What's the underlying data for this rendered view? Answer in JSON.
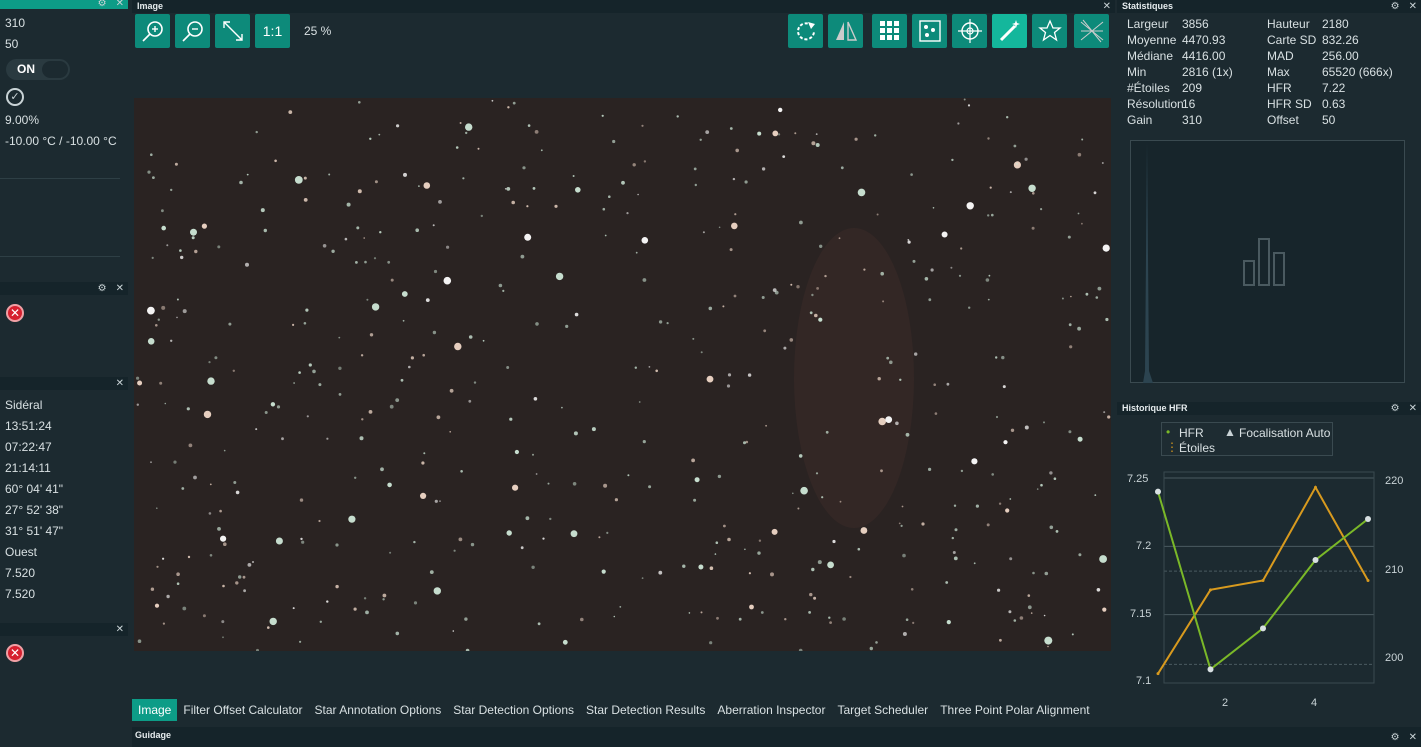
{
  "left": {
    "gain": "310",
    "offset": "50",
    "cooler_toggle": "ON",
    "cooler_power": "9.00%",
    "temperature": "-10.00 °C / -10.00 °C",
    "telescope": {
      "tracking": "Sidéral",
      "sidereal_time": "13:51:24",
      "time1": "07:22:47",
      "time2": "21:14:11",
      "coord1": "60° 04' 41\"",
      "coord2": "27° 52' 38\"",
      "coord3": "31° 51' 47\"",
      "pier_side": "Ouest",
      "value1": "7.520",
      "value2": "7.520"
    }
  },
  "image": {
    "title": "Image",
    "zoom": "25 %",
    "one_to_one": "1:1",
    "tabs": [
      "Image",
      "Filter Offset Calculator",
      "Star Annotation Options",
      "Star Detection Options",
      "Star Detection Results",
      "Aberration Inspector",
      "Target Scheduler",
      "Three Point Polar Alignment"
    ]
  },
  "stats": {
    "title": "Statistiques",
    "rows": [
      {
        "l1": "Largeur",
        "v1": "3856",
        "l2": "Hauteur",
        "v2": "2180"
      },
      {
        "l1": "Moyenne",
        "v1": "4470.93",
        "l2": "Carte SD",
        "v2": "832.26"
      },
      {
        "l1": "Médiane",
        "v1": "4416.00",
        "l2": "MAD",
        "v2": "256.00"
      },
      {
        "l1": "Min",
        "v1": "2816 (1x)",
        "l2": "Max",
        "v2": "65520 (666x)"
      },
      {
        "l1": "#Étoiles",
        "v1": "209",
        "l2": "HFR",
        "v2": "7.22"
      },
      {
        "l1": "Résolution",
        "v1": "16",
        "l2": "HFR SD",
        "v2": "0.63"
      },
      {
        "l1": "Gain",
        "v1": "310",
        "l2": "Offset",
        "v2": "50"
      }
    ]
  },
  "hfr": {
    "title": "Historique HFR",
    "legend": {
      "hfr": "HFR",
      "autofocus": "Focalisation Auto",
      "stars": "Étoiles"
    },
    "left_ticks": [
      "7.25",
      "7.2",
      "7.15",
      "7.1"
    ],
    "right_ticks": [
      "220",
      "210",
      "200"
    ],
    "x_ticks": [
      "2",
      "4"
    ]
  },
  "chart_data": {
    "type": "line",
    "x": [
      1,
      2,
      3,
      4,
      5
    ],
    "series": [
      {
        "name": "HFR",
        "values": [
          7.24,
          7.11,
          7.14,
          7.19,
          7.22
        ],
        "color": "#7ab828"
      },
      {
        "name": "Étoiles",
        "values": [
          199,
          208,
          209,
          219,
          209
        ],
        "color": "#d89a1e"
      }
    ],
    "ylim": [
      7.1,
      7.25
    ],
    "y2lim": [
      198,
      220
    ]
  },
  "guide": {
    "title": "Guidage"
  },
  "colors": {
    "accent": "#0d9c87",
    "panel": "#1c2a30",
    "error": "#d6202f"
  }
}
